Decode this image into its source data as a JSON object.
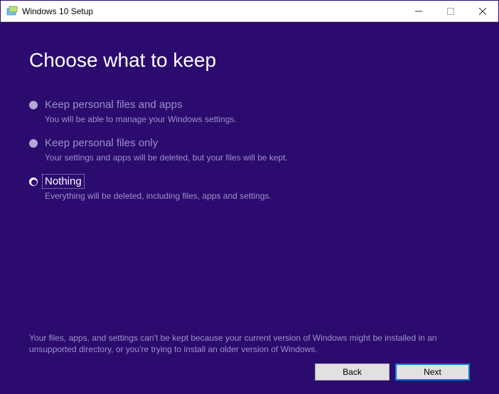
{
  "titlebar": {
    "title": "Windows 10 Setup"
  },
  "main": {
    "heading": "Choose what to keep",
    "options": [
      {
        "label": "Keep personal files and apps",
        "desc": "You will be able to manage your Windows settings.",
        "disabled": true,
        "selected": false
      },
      {
        "label": "Keep personal files only",
        "desc": "Your settings and apps will be deleted, but your files will be kept.",
        "disabled": true,
        "selected": false
      },
      {
        "label": "Nothing",
        "desc": "Everything will be deleted, including files, apps and settings.",
        "disabled": false,
        "selected": true
      }
    ],
    "footnote": "Your files, apps, and settings can't be kept because your current version of Windows might be installed in an unsupported directory, or you're trying to install an older version of Windows."
  },
  "buttons": {
    "back": "Back",
    "next": "Next"
  }
}
